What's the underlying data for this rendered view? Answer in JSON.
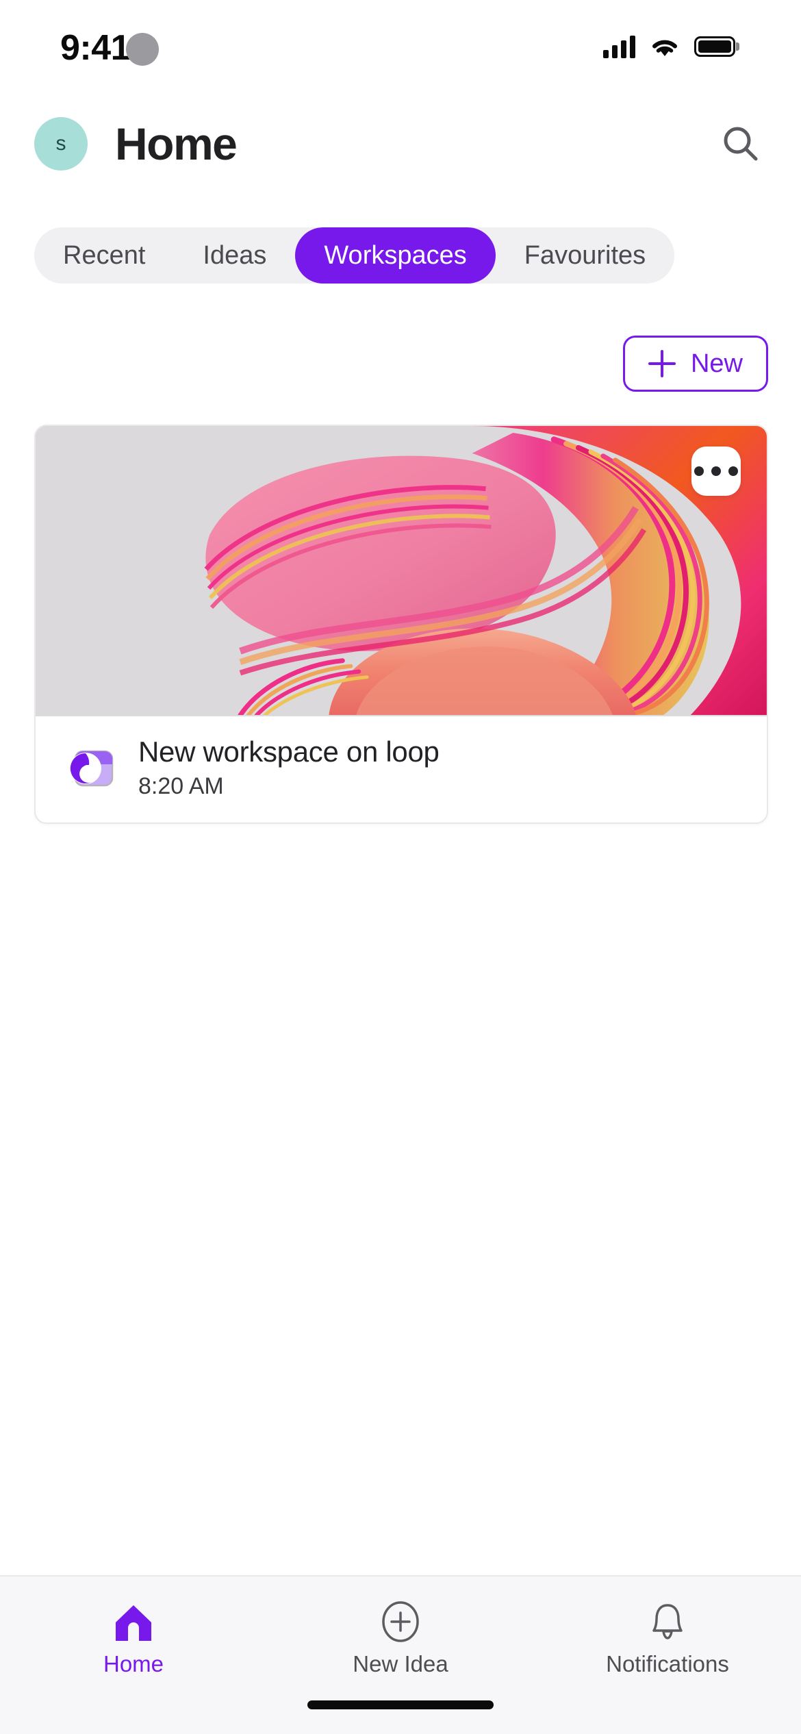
{
  "status_bar": {
    "time": "9:41",
    "cellular_icon": "signal-bars-icon",
    "wifi_icon": "wifi-icon",
    "battery_icon": "battery-full-icon",
    "privacy_dot": "recording-indicator-dot"
  },
  "header": {
    "avatar_initial": "s",
    "avatar_color": "#a8ded8",
    "avatar_text_color": "#1f4a46",
    "title": "Home",
    "search_icon": "search-icon"
  },
  "tabs": {
    "items": [
      {
        "label": "Recent",
        "active": false
      },
      {
        "label": "Ideas",
        "active": false
      },
      {
        "label": "Workspaces",
        "active": true
      },
      {
        "label": "Favourites",
        "active": false
      }
    ],
    "active_bg": "#7719ea",
    "track_bg": "#f0eff1"
  },
  "actions": {
    "new_label": "New",
    "new_icon": "plus-icon",
    "accent_color": "#7719ea"
  },
  "workspace_card": {
    "cover_alt": "abstract pink orange ribbon artwork",
    "cover_bg": "#dddade",
    "overflow_icon": "more-options-icon",
    "app_icon": "microsoft-loop-icon",
    "title": "New workspace on loop",
    "subtitle": "8:20 AM"
  },
  "bottom_nav": {
    "items": [
      {
        "label": "Home",
        "icon": "home-icon",
        "active": true
      },
      {
        "label": "New Idea",
        "icon": "plus-circle-icon",
        "active": false
      },
      {
        "label": "Notifications",
        "icon": "bell-icon",
        "active": false
      }
    ],
    "active_color": "#7719ea",
    "inactive_color": "#4d4d52"
  }
}
